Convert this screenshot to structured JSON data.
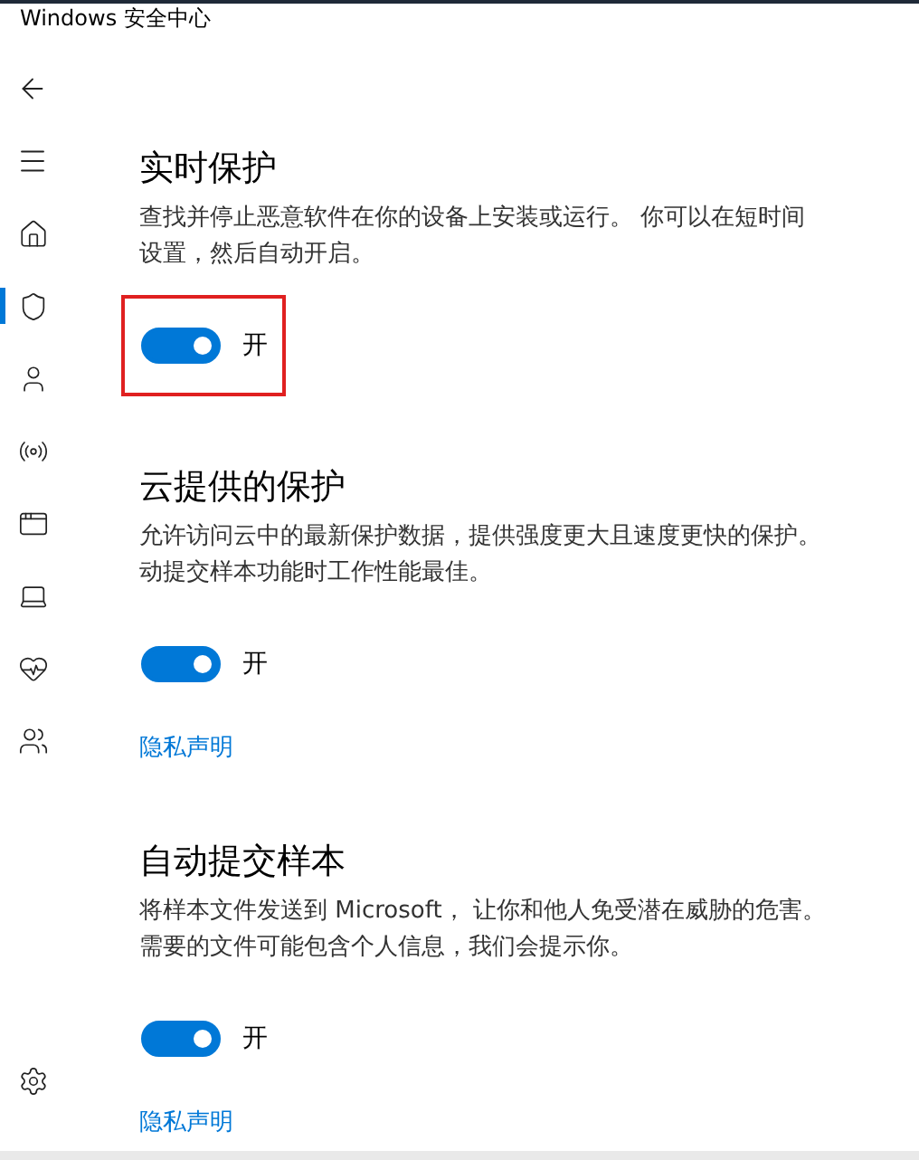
{
  "window": {
    "title": "Windows 安全中心"
  },
  "sidebar": {
    "items": [
      {
        "kind": "home",
        "selected": false
      },
      {
        "kind": "shield",
        "selected": true
      },
      {
        "kind": "person",
        "selected": false
      },
      {
        "kind": "signal",
        "selected": false
      },
      {
        "kind": "window",
        "selected": false
      },
      {
        "kind": "laptop",
        "selected": false
      },
      {
        "kind": "health",
        "selected": false
      },
      {
        "kind": "family",
        "selected": false
      }
    ]
  },
  "sections": [
    {
      "title": "实时保护",
      "description": [
        "查找并停止恶意软件在你的设备上安装或运行。 你可以在短时间",
        "设置，然后自动开启。"
      ],
      "on": true,
      "toggle_label": "开",
      "highlighted": true
    },
    {
      "title": "云提供的保护",
      "description": [
        "允许访问云中的最新保护数据，提供强度更大且速度更快的保护。",
        "动提交样本功能时工作性能最佳。"
      ],
      "on": true,
      "toggle_label": "开",
      "highlighted": false,
      "link": "隐私声明"
    },
    {
      "title": "自动提交样本",
      "description": [
        "将样本文件发送到 Microsoft， 让你和他人免受潜在威胁的危害。",
        "需要的文件可能包含个人信息，我们会提示你。"
      ],
      "on": true,
      "toggle_label": "开",
      "highlighted": false,
      "link": "隐私声明"
    }
  ]
}
